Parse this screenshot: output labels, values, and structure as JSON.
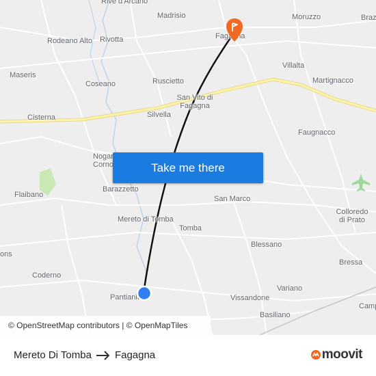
{
  "map": {
    "places": [
      {
        "id": "rive-d-arcano",
        "label": "Rive d'Arcano"
      },
      {
        "id": "madrisio",
        "label": "Madrisio"
      },
      {
        "id": "moruzzo",
        "label": "Moruzzo"
      },
      {
        "id": "brazz",
        "label": "Brazz"
      },
      {
        "id": "rodeano-alto",
        "label": "Rodeano Alto"
      },
      {
        "id": "rivotta",
        "label": "Rivotta"
      },
      {
        "id": "fagagna-label",
        "label": "Fagagna"
      },
      {
        "id": "maseris",
        "label": "Maseris"
      },
      {
        "id": "villalta",
        "label": "Villalta"
      },
      {
        "id": "coseano",
        "label": "Coseano"
      },
      {
        "id": "ruscietto",
        "label": "Ruscietto"
      },
      {
        "id": "martignacco",
        "label": "Martignacco"
      },
      {
        "id": "san-vito",
        "label": "San Vito di Fagagna"
      },
      {
        "id": "cisterna",
        "label": "Cisterna"
      },
      {
        "id": "silvella",
        "label": "Silvella"
      },
      {
        "id": "faugnacco",
        "label": "Faugnacco"
      },
      {
        "id": "nogaredo",
        "label": "Nogaredo di Corno"
      },
      {
        "id": "flaibano",
        "label": "Flaibano"
      },
      {
        "id": "barazzetto",
        "label": "Barazzetto"
      },
      {
        "id": "san-marco",
        "label": "San Marco"
      },
      {
        "id": "colloredo",
        "label": "Colloredo di Prato"
      },
      {
        "id": "mereto-di-tomba",
        "label": "Mereto di Tomba"
      },
      {
        "id": "tomba",
        "label": "Tomba"
      },
      {
        "id": "sons",
        "label": "ons"
      },
      {
        "id": "blessano",
        "label": "Blessano"
      },
      {
        "id": "bressa",
        "label": "Bressa"
      },
      {
        "id": "coderno",
        "label": "Coderno"
      },
      {
        "id": "variano",
        "label": "Variano"
      },
      {
        "id": "pantianicco",
        "label": "Pantianicco"
      },
      {
        "id": "vissandone",
        "label": "Vissandone"
      },
      {
        "id": "camp",
        "label": "Camp"
      },
      {
        "id": "basiliano",
        "label": "Basiliano"
      }
    ]
  },
  "cta": {
    "label": "Take me there"
  },
  "attribution": {
    "text": "© OpenStreetMap contributors | © OpenMapTiles"
  },
  "route": {
    "from": "Mereto Di Tomba",
    "to": "Fagagna"
  },
  "brand": {
    "name": "moovit",
    "color": "#f26a21"
  },
  "colors": {
    "accent": "#1a7be0",
    "destination_pin": "#f26a21",
    "origin_dot": "#2f7ff0",
    "motorway": "#fdf3a8"
  }
}
